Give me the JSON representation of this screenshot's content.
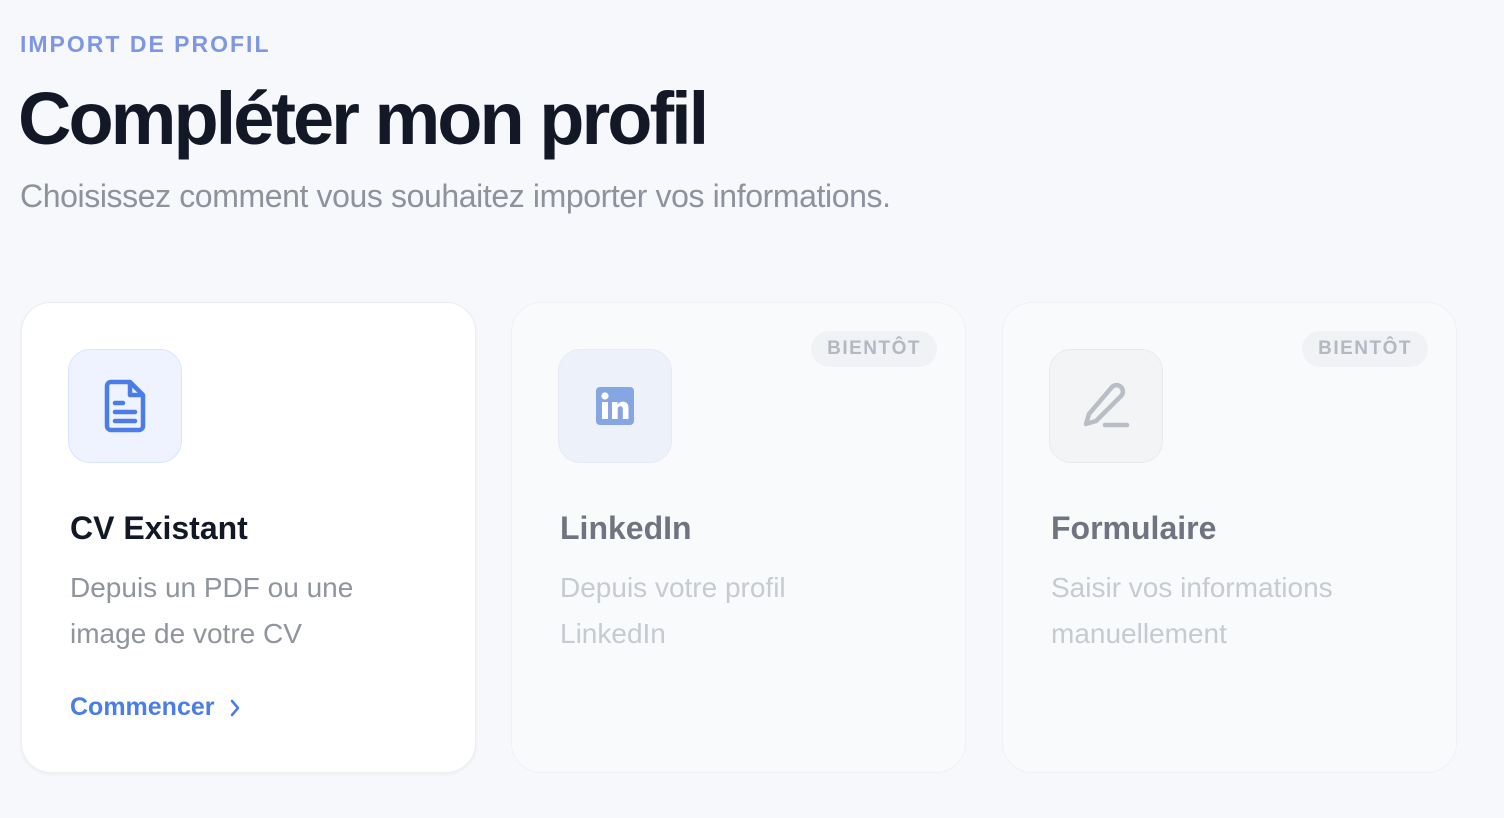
{
  "header": {
    "eyebrow": "IMPORT DE PROFIL",
    "title": "Compléter mon profil",
    "subtitle": "Choisissez comment vous souhaitez importer vos informations."
  },
  "cards": [
    {
      "icon": "document-icon",
      "title": "CV Existant",
      "description": "Depuis un PDF ou une image de votre CV",
      "cta": "Commencer",
      "state": "enabled"
    },
    {
      "icon": "linkedin-icon",
      "title": "LinkedIn",
      "description": "Depuis votre profil LinkedIn",
      "badge": "BIENTÔT",
      "state": "disabled"
    },
    {
      "icon": "pencil-icon",
      "title": "Formulaire",
      "description": "Saisir vos informations manuellement",
      "badge": "BIENTÔT",
      "state": "disabled"
    }
  ],
  "colors": {
    "accent": "#4b7de6",
    "eyebrow": "#7f97e3",
    "title": "#121826",
    "background": "#f7f8fb"
  }
}
